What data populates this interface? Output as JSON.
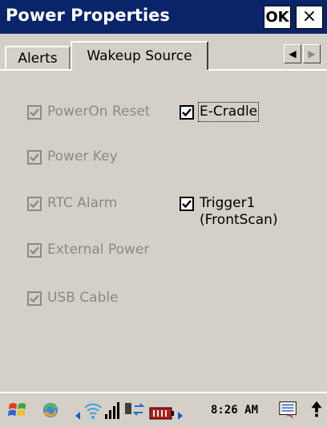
{
  "window": {
    "title": "Power Properties",
    "ok_label": "OK",
    "close_label": "×"
  },
  "tabs": [
    {
      "label": "Alerts",
      "selected": false
    },
    {
      "label": "Wakeup Source",
      "selected": true
    }
  ],
  "checkboxes": [
    {
      "label": "PowerOn Reset",
      "checked": true,
      "enabled": false
    },
    {
      "label": "Power Key",
      "checked": true,
      "enabled": false
    },
    {
      "label": "RTC Alarm",
      "checked": true,
      "enabled": false
    },
    {
      "label": "External Power",
      "checked": true,
      "enabled": false
    },
    {
      "label": "USB Cable",
      "checked": true,
      "enabled": false
    },
    {
      "label": "E-Cradle",
      "checked": true,
      "enabled": true
    },
    {
      "label": "Trigger1",
      "label_line2": "(FrontScan)",
      "checked": true,
      "enabled": true
    }
  ],
  "taskbar": {
    "time": "8:26 AM"
  },
  "colors": {
    "titlebar": "#0a246a",
    "panel": "#d4d0c8",
    "disabled_text": "#8a8a8a"
  }
}
